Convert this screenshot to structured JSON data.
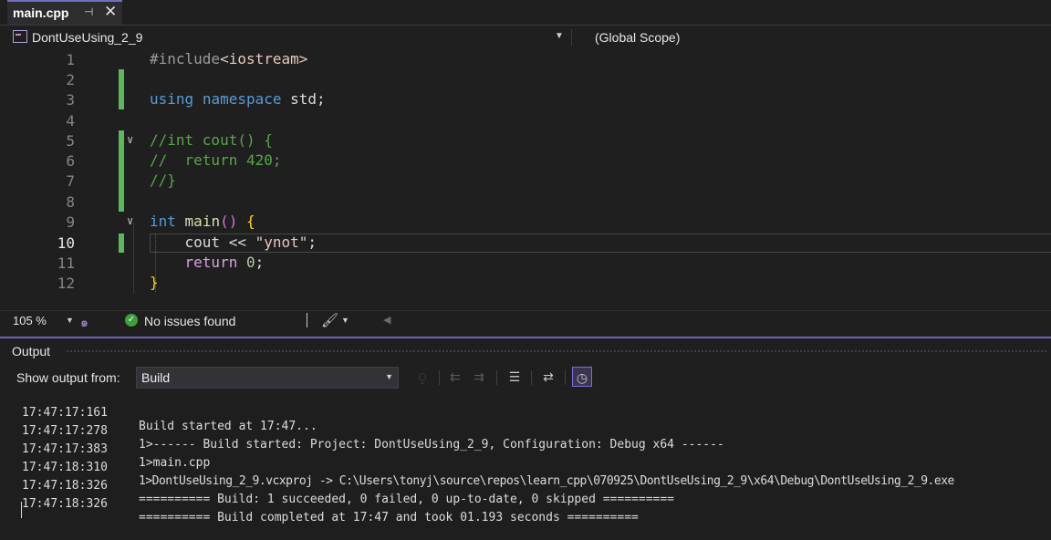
{
  "tab": {
    "label": "main.cpp",
    "pin_icon": "pin-icon",
    "close_icon": "close-icon"
  },
  "navbar": {
    "project": "DontUseUsing_2_9",
    "scope": "(Global Scope)"
  },
  "editor": {
    "lines": [
      {
        "n": "1"
      },
      {
        "n": "2"
      },
      {
        "n": "3"
      },
      {
        "n": "4"
      },
      {
        "n": "5"
      },
      {
        "n": "6"
      },
      {
        "n": "7"
      },
      {
        "n": "8"
      },
      {
        "n": "9"
      },
      {
        "n": "10"
      },
      {
        "n": "11"
      },
      {
        "n": "12"
      }
    ],
    "code": {
      "l1_pp": "#include",
      "l1_inc": "<iostream>",
      "l3_kw1": "using",
      "l3_kw2": "namespace",
      "l3_rest": " std;",
      "l5": "//int cout() {",
      "l6": "//  return 420;",
      "l7": "//}",
      "l9_kw": "int",
      "l9_fn": "main",
      "l9_paren": "()",
      "l9_brace": "{",
      "l10_id": "cout",
      "l10_op": " << ",
      "l10_str": "\"ynot\"",
      "l10_semi": ";",
      "l11_kw": "return",
      "l11_num": "0",
      "l11_semi": ";",
      "l12_brace": "}"
    },
    "active_line": "10"
  },
  "editor_status": {
    "zoom": "105 %",
    "issues": "No issues found"
  },
  "output": {
    "title": "Output",
    "show_label": "Show output from:",
    "source": "Build",
    "lines": [
      {
        "ts": "17:47:17:161",
        "text": "Build started at 17:47..."
      },
      {
        "ts": "17:47:17:278",
        "text": "1>------ Build started: Project: DontUseUsing_2_9, Configuration: Debug x64 ------"
      },
      {
        "ts": "17:47:17:383",
        "text": "1>main.cpp"
      },
      {
        "ts": "17:47:18:310",
        "text": "1>DontUseUsing_2_9.vcxproj -> C:\\Users\\tonyj\\source\\repos\\learn_cpp\\070925\\DontUseUsing_2_9\\x64\\Debug\\DontUseUsing_2_9.exe"
      },
      {
        "ts": "17:47:18:326",
        "text": "========== Build: 1 succeeded, 0 failed, 0 up-to-date, 0 skipped =========="
      },
      {
        "ts": "17:47:18:326",
        "text": "========== Build completed at 17:47 and took 01.193 seconds =========="
      }
    ]
  },
  "colors": {
    "accent": "#7761b8",
    "change_bar": "#5cb85c",
    "keyword": "#569cd6",
    "comment": "#57a64a"
  }
}
